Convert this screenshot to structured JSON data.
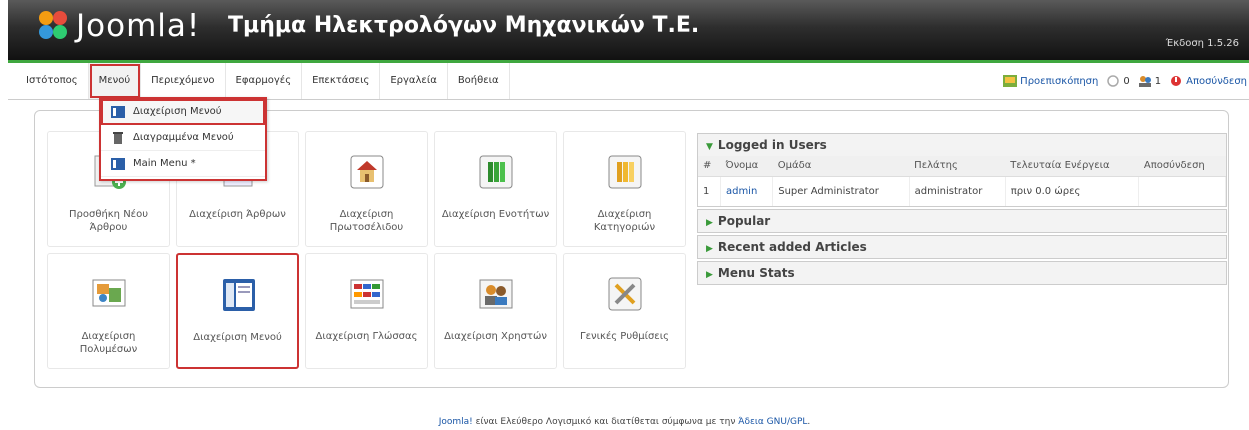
{
  "header": {
    "logo_text": "Joomla!",
    "site_title": "Τμήμα Ηλεκτρολόγων Μηχανικών Τ.Ε.",
    "version": "Έκδοση 1.5.26"
  },
  "menubar": {
    "items": [
      "Ιστότοπος",
      "Μενού",
      "Περιεχόμενο",
      "Εφαρμογές",
      "Επεκτάσεις",
      "Εργαλεία",
      "Βοήθεια"
    ],
    "preview": "Προεπισκόπηση",
    "messages_count": "0",
    "users_count": "1",
    "logout": "Αποσύνδεση"
  },
  "dropdown": {
    "items": [
      "Διαχείριση Μενού",
      "Διαγραμμένα Μενού",
      "Main Menu *"
    ]
  },
  "cpanel": {
    "tiles": [
      {
        "label": "Προσθήκη Νέου Άρθρου",
        "icon": "add-article-icon"
      },
      {
        "label": "Διαχείριση Άρθρων",
        "icon": "articles-icon"
      },
      {
        "label": "Διαχείριση Πρωτοσέλιδου",
        "icon": "frontpage-icon"
      },
      {
        "label": "Διαχείριση Ενοτήτων",
        "icon": "sections-icon"
      },
      {
        "label": "Διαχείριση Κατηγοριών",
        "icon": "categories-icon"
      },
      {
        "label": "Διαχείριση Πολυμέσων",
        "icon": "media-icon"
      },
      {
        "label": "Διαχείριση Μενού",
        "icon": "menu-icon"
      },
      {
        "label": "Διαχείριση Γλώσσας",
        "icon": "language-icon"
      },
      {
        "label": "Διαχείριση Χρηστών",
        "icon": "users-icon"
      },
      {
        "label": "Γενικές Ρυθμίσεις",
        "icon": "settings-icon"
      }
    ]
  },
  "modules": {
    "logged_in": {
      "title": "Logged in Users",
      "columns": [
        "#",
        "Όνομα",
        "Ομάδα",
        "Πελάτης",
        "Τελευταία Ενέργεια",
        "Αποσύνδεση"
      ],
      "rows": [
        [
          "1",
          "admin",
          "Super Administrator",
          "administrator",
          "πριν 0.0 ώρες",
          ""
        ]
      ]
    },
    "popular": "Popular",
    "recent": "Recent added Articles",
    "menu_stats": "Menu Stats"
  },
  "footer": {
    "joomla": "Joomla!",
    "text": " είναι Ελεύθερο Λογισμικό και διατίθεται σύμφωνα με την ",
    "license": "Άδεια GNU/GPL",
    "end": "."
  },
  "colors": {
    "accent_green": "#3fa73f",
    "highlight_red": "#cc3333",
    "link_blue": "#1a56a6"
  }
}
